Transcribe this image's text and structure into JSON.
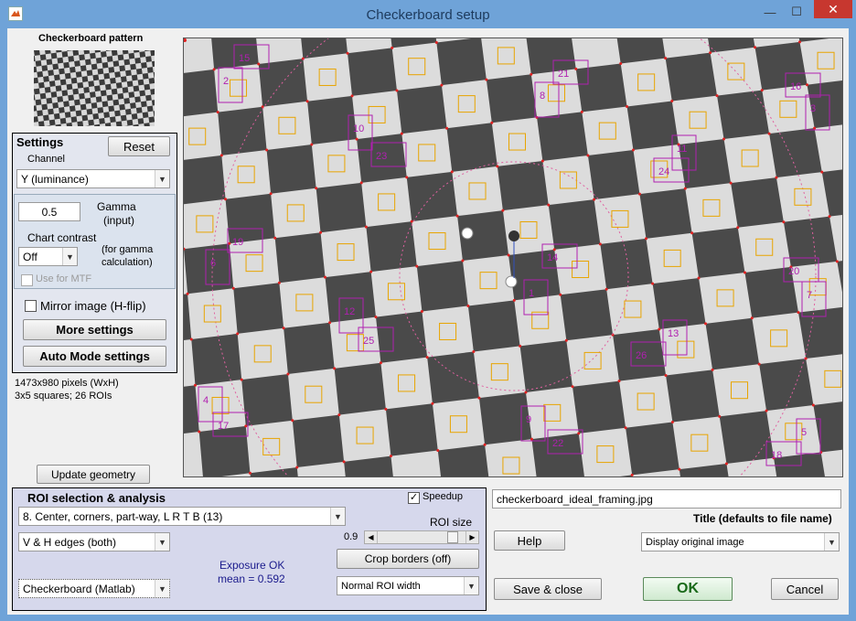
{
  "window": {
    "title": "Checkerboard setup",
    "min_glyph": "—",
    "max_glyph": "☐",
    "close_glyph": "✕"
  },
  "pattern": {
    "heading": "Checkerboard pattern"
  },
  "settings": {
    "heading": "Settings",
    "reset_label": "Reset",
    "channel_label": "Channel",
    "channel_value": "Y (luminance)",
    "gamma_value": "0.5",
    "gamma_label_1": "Gamma",
    "gamma_label_2": "(input)",
    "chart_contrast_label": "Chart contrast",
    "contrast_value": "Off",
    "contrast_note_1": "(for gamma",
    "contrast_note_2": "calculation)",
    "use_for_mtf_label": "Use for MTF",
    "mirror_label": "Mirror image (H-flip)",
    "more_settings_label": "More settings",
    "auto_mode_label": "Auto Mode settings"
  },
  "info": {
    "pixels": "1473x980 pixels (WxH)",
    "squares": "3x5 squares;   26 ROIs"
  },
  "update_geometry_label": "Update geometry",
  "roi": {
    "heading": "ROI selection & analysis",
    "speedup_label": "Speedup",
    "speedup_checked": "✓",
    "selection_value": "8.   Center, corners, part-way, L R T B (13)",
    "edges_value": "V & H edges (both)",
    "roi_size_label": "ROI size",
    "roi_size_value": 0.9,
    "roi_size_text": "0.9",
    "crop_label": "Crop borders  (off)",
    "exposure_1": "Exposure OK",
    "exposure_2": "mean = 0.592",
    "method_value": "Checkerboard (Matlab)",
    "width_value": "Normal ROI width"
  },
  "file": {
    "name": "checkerboard_ideal_framing.jpg",
    "title_label": "Title (defaults to file name)",
    "help_label": "Help",
    "display_value": "Display original image",
    "save_close_label": "Save & close",
    "ok_label": "OK",
    "cancel_label": "Cancel"
  },
  "board": {
    "roi_labels": [
      "1",
      "2",
      "3",
      "4",
      "5",
      "6",
      "7",
      "8",
      "9",
      "10",
      "11",
      "12",
      "13",
      "14",
      "15",
      "16",
      "17",
      "18",
      "19",
      "20",
      "21",
      "22",
      "23",
      "24",
      "25",
      "26"
    ],
    "colors": {
      "dark": "#4a4a4a",
      "light": "#dcdcdc",
      "roi": "#e8a400",
      "roi_id": "#b020b0",
      "corner": "#e02020"
    }
  }
}
